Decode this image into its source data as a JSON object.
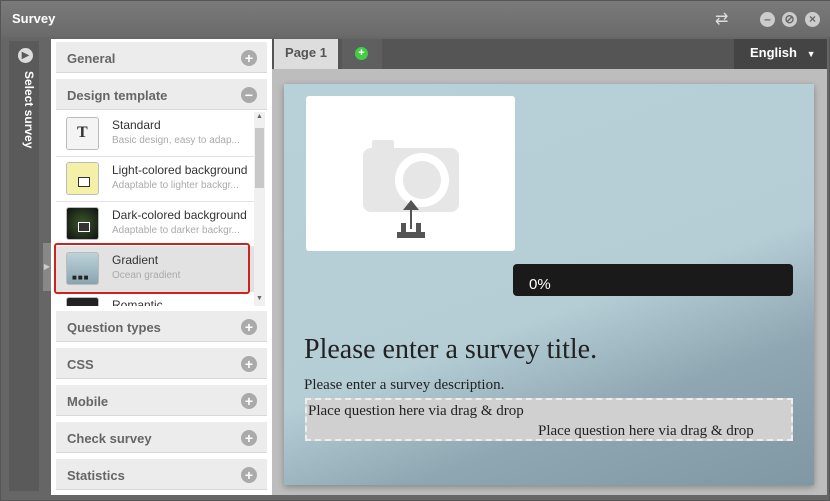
{
  "window": {
    "title": "Survey"
  },
  "side": {
    "label": "Select survey"
  },
  "accordion": {
    "general": "General",
    "design_template": "Design template",
    "question_types": "Question types",
    "css": "CSS",
    "mobile": "Mobile",
    "check_survey": "Check survey",
    "statistics": "Statistics"
  },
  "templates": [
    {
      "name": "Standard",
      "desc": "Basic design, easy to adap..."
    },
    {
      "name": "Light-colored background",
      "desc": "Adaptable to lighter backgr..."
    },
    {
      "name": "Dark-colored background",
      "desc": "Adaptable to darker backgr..."
    },
    {
      "name": "Gradient",
      "desc": "Ocean gradient"
    },
    {
      "name": "Romantic",
      "desc": ""
    }
  ],
  "selected_template": "Gradient",
  "tabs": {
    "page1": "Page 1",
    "add": "+"
  },
  "language": "English",
  "survey": {
    "progress": "0%",
    "title": "Please enter a survey title.",
    "description": "Please enter a survey description.",
    "drop_hint_1": "Place question here via drag & drop",
    "drop_hint_2": "Place question here via drag & drop"
  },
  "colors": {
    "selection_border": "#cc2222",
    "progress_bg": "#1a1a1a"
  }
}
